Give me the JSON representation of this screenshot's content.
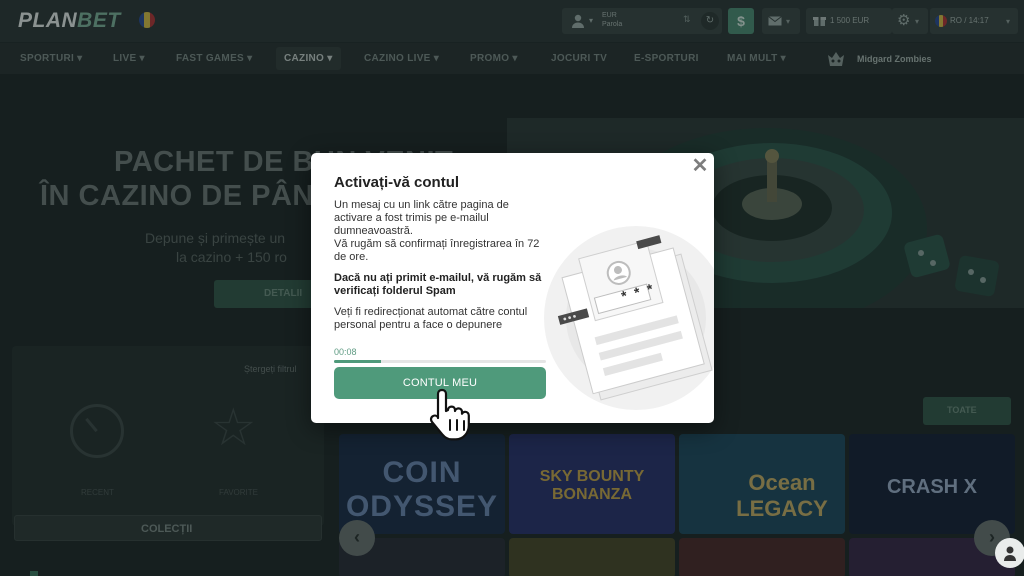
{
  "header": {
    "logo_plan": "PLAN",
    "logo_bet": "BET",
    "account_line1": "EUR",
    "account_line2": "Parola",
    "gift_amount": "1 500 EUR",
    "lang_time": "RO / 14:17"
  },
  "nav": {
    "items": [
      "SPORTURI",
      "LIVE",
      "FAST GAMES",
      "CAZINO",
      "CAZINO LIVE",
      "PROMO",
      "JOCURI TV",
      "E-SPORTURI",
      "MAI MULT"
    ],
    "active": "CAZINO",
    "promo_label": "Midgard Zombies"
  },
  "hero": {
    "line1": "PACHET DE BUN VENIT",
    "line2": "ÎN CAZINO DE PÂN",
    "sub1": "Depune și primește un",
    "sub2": "la cazino + 150 ro",
    "button": "DETALII"
  },
  "side_panel": {
    "title": "Ștergeți filtrul",
    "label_recent": "RECENT",
    "label_fav": "FAVORITE",
    "collections": "COLECȚII"
  },
  "games_section": {
    "all_games": "TOATE",
    "tiles": [
      "COIN ODYSSEY",
      "SKY BOUNTY BONANZA",
      "Ocean LEGACY",
      "CRASH X"
    ]
  },
  "modal": {
    "title": "Activați-vă contul",
    "para1": "Un mesaj cu un link către pagina de activare a fost trimis pe e-mailul dumneavoastră.\nVă rugăm să confirmați înregistrarea în 72 de ore.",
    "para2": "Dacă nu ați primit e-mailul, vă rugăm să verificați folderul Spam",
    "para3": "Veți fi redirecționat automat către contul personal pentru a face o depunere",
    "timer": "00:08",
    "progress_fraction": 0.22,
    "button": "CONTUL MEU",
    "password_mask": "* * *"
  },
  "colors": {
    "accent": "#4f9a7b",
    "header_bg": "#2d3a39",
    "page_bg": "#1f2a2a"
  },
  "icons": [
    "user-icon",
    "refresh-icon",
    "deposit-icon",
    "mail-icon",
    "gift-icon",
    "gear-icon",
    "flag-icon",
    "close-icon",
    "hand-pointer-icon",
    "chat-icon",
    "chevron-left-icon",
    "chevron-right-icon",
    "star-icon",
    "clock-icon"
  ]
}
